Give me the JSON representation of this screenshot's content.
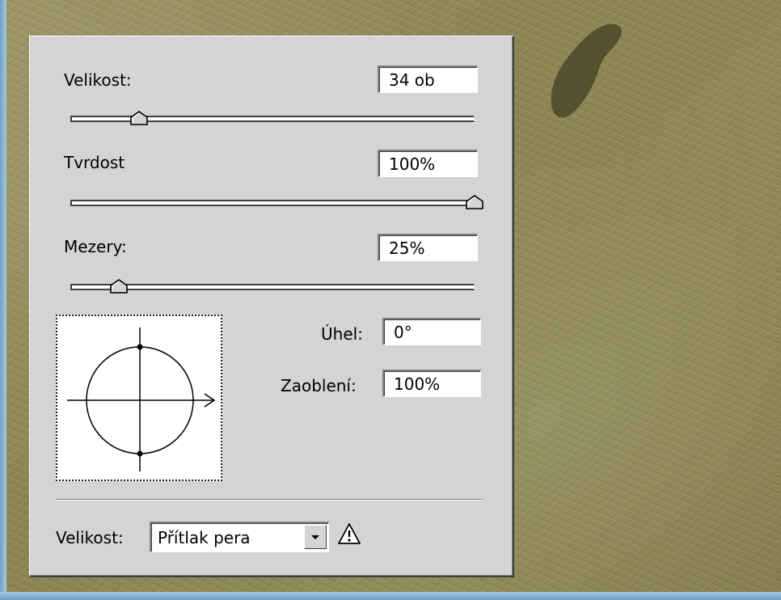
{
  "brush_panel": {
    "size_label": "Velikost:",
    "size_value": "34 ob",
    "size_slider_level": 0.17,
    "hardness_label": "Tvrdost",
    "hardness_value": "100%",
    "hardness_slider_level": 1.0,
    "spacing_label": "Mezery:",
    "spacing_value": "25%",
    "spacing_slider_level": 0.12,
    "angle_label": "Úhel:",
    "angle_value": "0°",
    "roundness_label": "Zaoblení:",
    "roundness_value": "100%",
    "control_label": "Velikost:",
    "control_value": "Přítlak pera",
    "control_options": [
      "Přítlak pera"
    ]
  },
  "icons": {
    "dropdown": "chevron-down-icon",
    "warning": "warning-icon",
    "slider_thumb": "slider-thumb-icon",
    "brush_preview": "brush-shape-preview"
  },
  "colors": {
    "panel": "#d4d4d4",
    "background": "#8a8450",
    "screen_edge": "#6fa0c6"
  }
}
